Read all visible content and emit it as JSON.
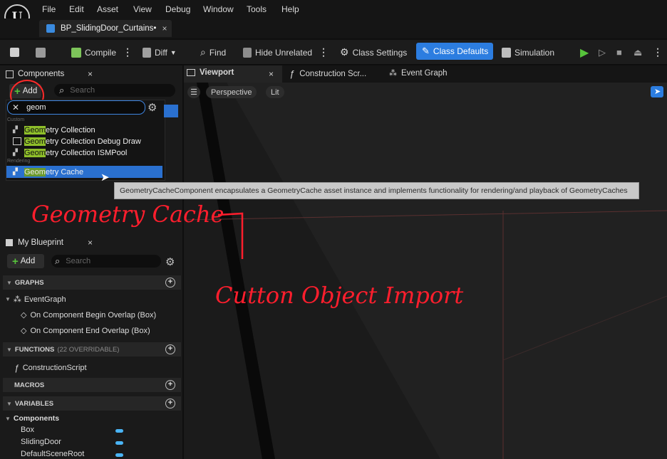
{
  "app": {
    "logo": "U"
  },
  "menu": [
    "File",
    "Edit",
    "Asset",
    "View",
    "Debug",
    "Window",
    "Tools",
    "Help"
  ],
  "document_tab": {
    "title": "BP_SlidingDoor_Curtains•",
    "close": "×"
  },
  "toolbar": {
    "compile": "Compile",
    "diff": "Diff",
    "find": "Find",
    "hide_unrelated": "Hide Unrelated",
    "class_settings": "Class Settings",
    "class_defaults": "Class Defaults",
    "simulation": "Simulation"
  },
  "components_panel": {
    "tab_label": "Components",
    "close": "×",
    "add_label": "Add",
    "search_placeholder": "Search",
    "filter_text": "geom"
  },
  "dropdown": {
    "categories": {
      "custom": "Custom",
      "rendering": "Rendering"
    },
    "match": "Geom",
    "items": [
      {
        "prefix": "Geom",
        "rest": "etry Collection"
      },
      {
        "prefix": "Geom",
        "rest": "etry Collection Debug Draw"
      },
      {
        "prefix": "Geom",
        "rest": "etry Collection ISMPool"
      },
      {
        "prefix": "Geom",
        "rest": "etry Cache"
      }
    ]
  },
  "tooltip": "GeometryCacheComponent encapsulates a GeometryCache asset instance and implements functionality for rendering/and playback of GeometryCaches",
  "my_blueprint": {
    "tab_label": "My Blueprint",
    "close": "×",
    "add_label": "Add",
    "search_placeholder": "Search",
    "sections": {
      "graphs": "GRAPHS",
      "functions": "FUNCTIONS",
      "functions_count": "(22 OVERRIDABLE)",
      "macros": "MACROS",
      "variables": "VARIABLES"
    },
    "graph_items": {
      "event_graph": "EventGraph",
      "begin_overlap": "On Component Begin Overlap (Box)",
      "end_overlap": "On Component End Overlap (Box)"
    },
    "function_items": {
      "construction": "ConstructionScript"
    },
    "variable_group": "Components",
    "variables": [
      "Box",
      "SlidingDoor",
      "DefaultSceneRoot"
    ]
  },
  "viewport_tabs": {
    "viewport": "Viewport",
    "construction": "Construction Scr...",
    "event_graph": "Event Graph",
    "close": "×"
  },
  "viewport_controls": {
    "perspective": "Perspective",
    "lit": "Lit"
  },
  "annotations": {
    "a1": "Geometry Cache",
    "a2": "Cutton Object Import"
  },
  "colors": {
    "accent_blue": "#2c7de0",
    "highlight_green": "#8fbf2a",
    "annotation_red": "#ff1e2d"
  }
}
